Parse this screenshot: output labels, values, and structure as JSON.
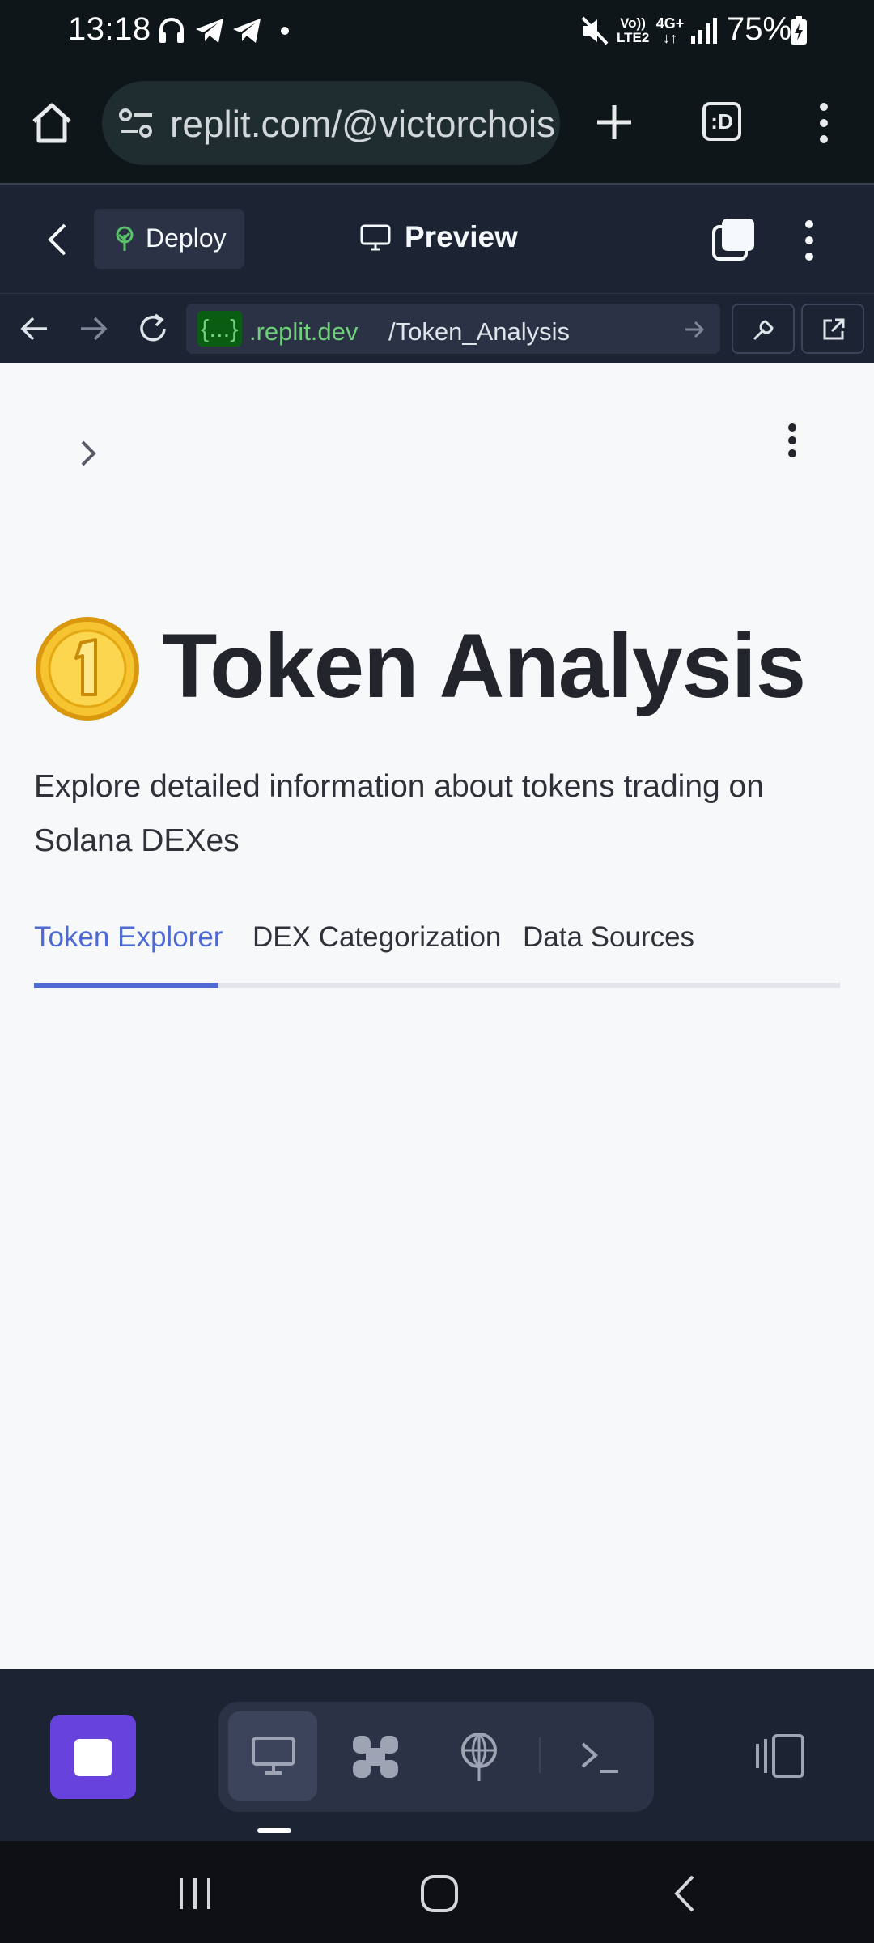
{
  "status_bar": {
    "time": "13:18",
    "battery": "75%",
    "network_top": "Vo))",
    "network_bottom": "LTE2",
    "data_type": "4G+"
  },
  "browser": {
    "url": "replit.com/@victorchois",
    "tab_count": ":D"
  },
  "replit_header": {
    "deploy_label": "Deploy",
    "preview_title": "Preview"
  },
  "webview": {
    "host_badge": "{...}",
    "host": ".replit.dev",
    "path": "/Token_Analysis"
  },
  "app": {
    "title": "Token Analysis",
    "subtitle": "Explore detailed information about tokens trading on Solana DEXes",
    "tabs": [
      {
        "label": "Token Explorer",
        "active": true
      },
      {
        "label": "DEX Categorization",
        "active": false
      },
      {
        "label": "Data Sources",
        "active": false
      }
    ],
    "accent_color": "#4f6ad2",
    "coin_icon": "coin-icon"
  },
  "bottom_toolbar": {
    "stop_color": "#6742dc",
    "icons": [
      "desktop-icon",
      "puzzle-icon",
      "globe-icon",
      "terminal-icon",
      "split-view-icon"
    ]
  }
}
